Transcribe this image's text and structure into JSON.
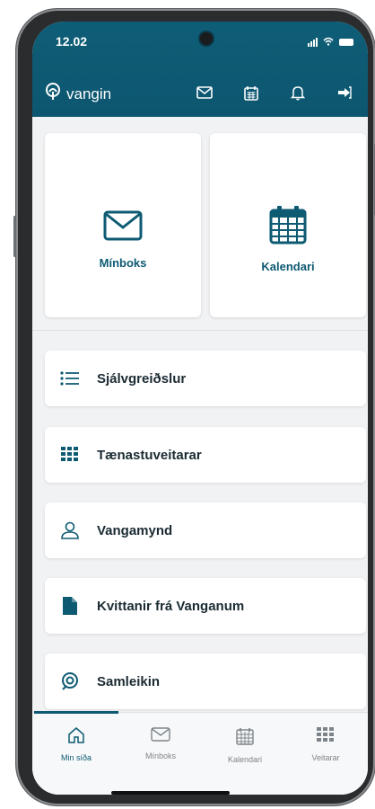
{
  "status_bar": {
    "time": "12.02"
  },
  "header": {
    "brand": "vangin"
  },
  "tiles": [
    {
      "label": "Mínboks"
    },
    {
      "label": "Kalendari"
    }
  ],
  "list": [
    {
      "label": "Sjálvgreiðslur"
    },
    {
      "label": "Tænastuveitarar"
    },
    {
      "label": "Vangamynd"
    },
    {
      "label": "Kvittanir frá Vanganum"
    },
    {
      "label": "Samleikin"
    }
  ],
  "bottom_nav": [
    {
      "label": "Min síða",
      "active": true
    },
    {
      "label": "Mínboks"
    },
    {
      "label": "Kalendari"
    },
    {
      "label": "Veitarar"
    }
  ],
  "colors": {
    "brand": "#0e5a73",
    "background": "#f1f2f4"
  }
}
